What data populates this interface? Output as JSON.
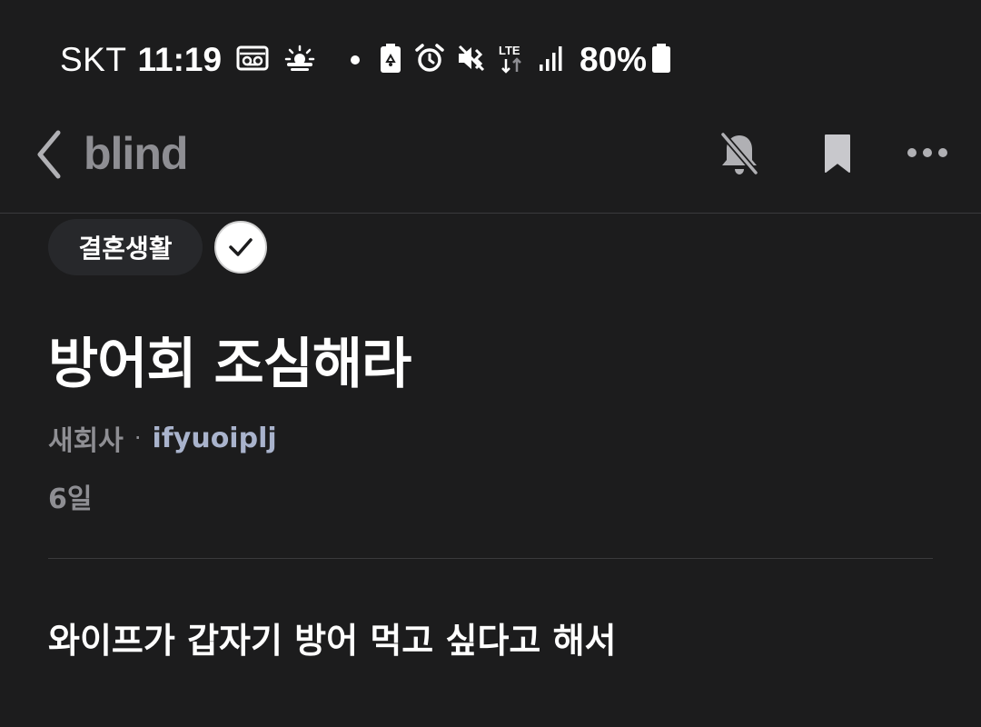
{
  "status_bar": {
    "carrier": "SKT",
    "time": "11:19",
    "battery_percent": "80%",
    "network": "LTE",
    "icons": [
      "voicemail-icon",
      "weather-sun-cloud-icon",
      "notification-dot",
      "battery-saver-icon",
      "alarm-icon",
      "vibrate-mute-icon",
      "lte-data-icon",
      "signal-icon",
      "battery-icon"
    ]
  },
  "app_bar": {
    "brand": "blind",
    "icons": [
      "back-chevron-icon",
      "bell-off-icon",
      "bookmark-icon",
      "more-dots-icon"
    ]
  },
  "post": {
    "tag": "결혼생활",
    "title": "방어회 조심해라",
    "company": "새회사",
    "separator": "·",
    "author": "ifyuoiplj",
    "time_ago": "6일",
    "body": "와이프가 갑자기 방어 먹고 싶다고 해서"
  },
  "colors": {
    "background": "#1c1c1d",
    "muted": "#8e8e93",
    "author": "#a9b3cc",
    "chip": "#27282b"
  }
}
